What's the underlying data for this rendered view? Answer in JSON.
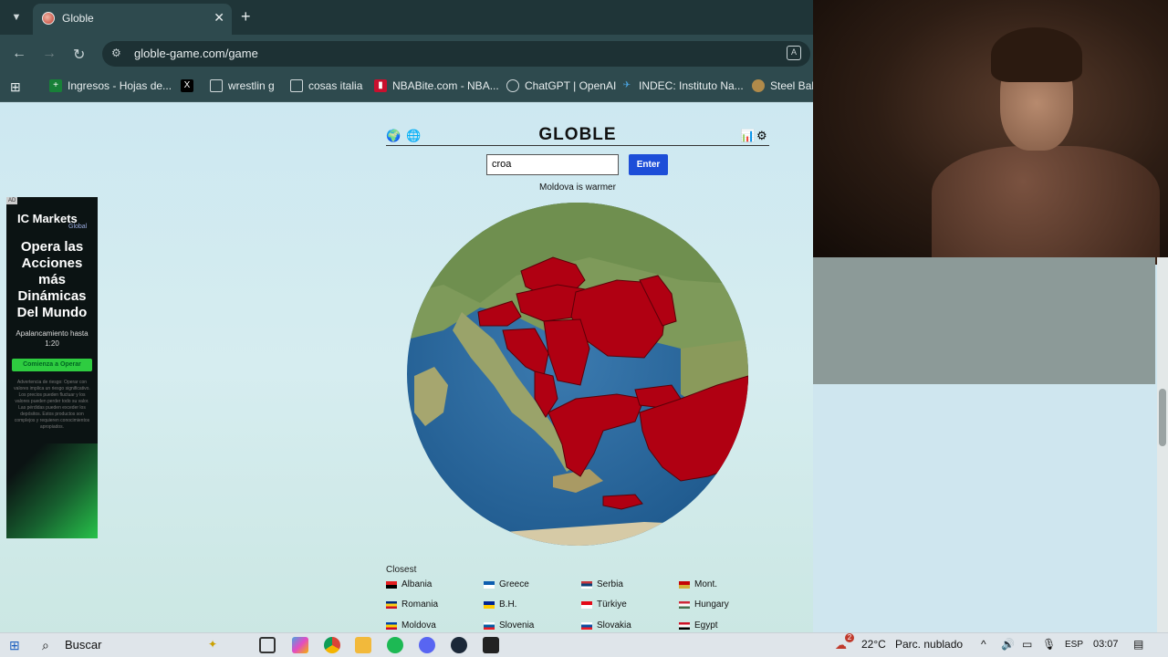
{
  "browser": {
    "tab_title": "Globle",
    "url": "globle-game.com/game",
    "bookmarks": [
      "Ingresos - Hojas de...",
      "wrestlin g",
      "cosas italia",
      "NBABite.com - NBA...",
      "ChatGPT | OpenAI",
      "INDEC: Instituto Na...",
      "Steel Ball"
    ]
  },
  "ad": {
    "tag": "AD",
    "brand": "IC Markets",
    "brand_sub": "Global",
    "headline": "Opera las Acciones más Dinámicas Del Mundo",
    "sub": "Apalancamiento hasta 1:20",
    "cta": "Comienza a Operar",
    "fine": "Advertencia de riesgo: Operar con valores implica un riesgo significativo. Los precios pueden fluctuar y los valores pueden perder todo su valor. Las pérdidas pueden exceder los depósitos. Estos productos son complejos y requieren conocimientos apropiados."
  },
  "game": {
    "title": "GLOBLE",
    "input_value": "croa",
    "enter_label": "Enter",
    "feedback": "Moldova is warmer",
    "closest_label": "Closest",
    "closest": [
      {
        "name": "Albania",
        "colors": [
          "#e41e20",
          "#000000"
        ]
      },
      {
        "name": "Greece",
        "colors": [
          "#0d5eaf",
          "#ffffff"
        ]
      },
      {
        "name": "Serbia",
        "colors": [
          "#c6363c",
          "#0c4076",
          "#ffffff"
        ]
      },
      {
        "name": "Mont.",
        "colors": [
          "#c40308",
          "#d4af3a"
        ]
      },
      {
        "name": "Romania",
        "colors": [
          "#002b7f",
          "#fcd116",
          "#ce1126"
        ]
      },
      {
        "name": "B.H.",
        "colors": [
          "#002395",
          "#fecb00"
        ]
      },
      {
        "name": "Türkiye",
        "colors": [
          "#e30a17",
          "#ffffff"
        ]
      },
      {
        "name": "Hungary",
        "colors": [
          "#ce2939",
          "#ffffff",
          "#477050"
        ]
      },
      {
        "name": "Moldova",
        "colors": [
          "#0046ae",
          "#ffd200",
          "#cc092f"
        ]
      },
      {
        "name": "Slovenia",
        "colors": [
          "#ffffff",
          "#005da4",
          "#ed1c24"
        ]
      },
      {
        "name": "Slovakia",
        "colors": [
          "#ffffff",
          "#0b4ea2",
          "#ee1c25"
        ]
      },
      {
        "name": "Egypt",
        "colors": [
          "#ce1126",
          "#ffffff",
          "#000000"
        ]
      }
    ]
  },
  "taskbar": {
    "search_label": "Buscar",
    "weather": "22°C",
    "weather_desc": "Parc. nublado",
    "badge": "2",
    "lang": "ESP",
    "time": "03:07"
  },
  "colors": {
    "guessed_country": "#b00012",
    "enter_button": "#1d4ed8"
  }
}
